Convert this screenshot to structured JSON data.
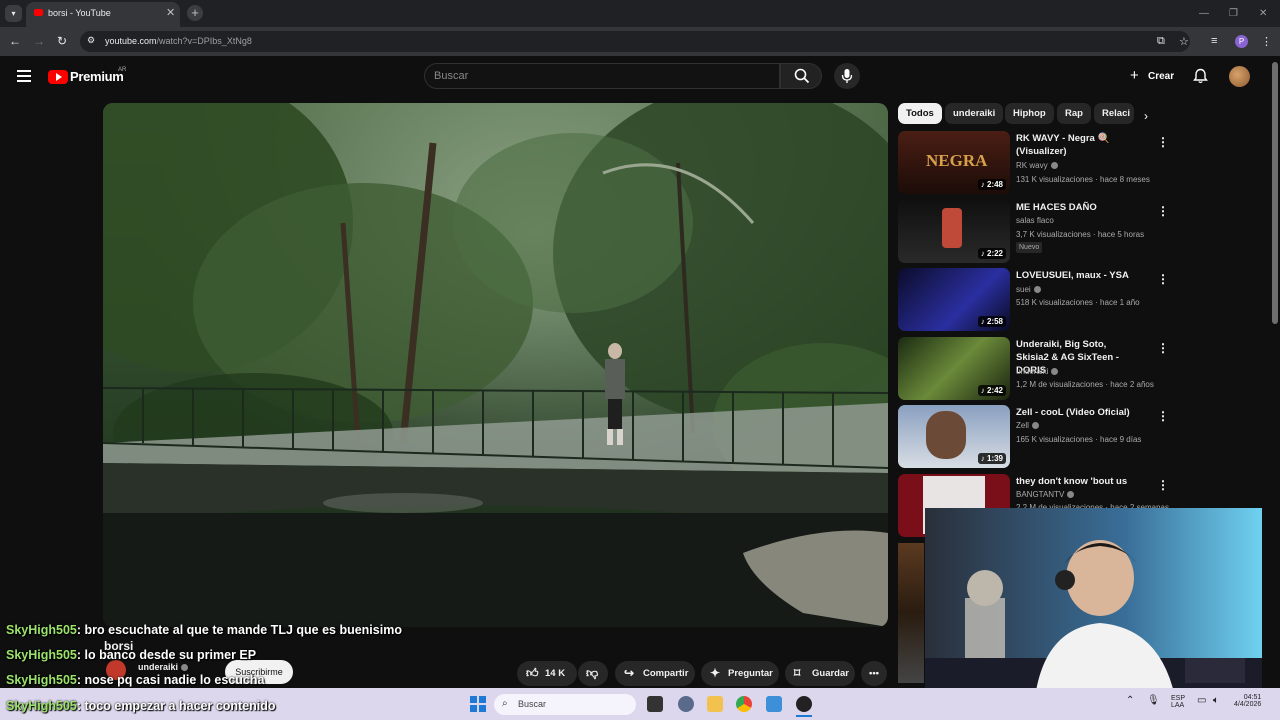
{
  "browser": {
    "tab_title": "borsi - YouTube",
    "url_host": "youtube.com",
    "url_path": "/watch?v=DPIbs_XtNg8",
    "profile_initial": "P"
  },
  "header": {
    "brand": "Premium",
    "country": "AR",
    "search_placeholder": "Buscar",
    "create_label": "Crear"
  },
  "chips": [
    "Todos",
    "underaiki",
    "Hiphop",
    "Rap",
    "Relaci"
  ],
  "recommendations": [
    {
      "title": "RK WAVY - Negra 🍭 (Visualizer)",
      "channel": "RK wavy",
      "meta": "131 K visualizaciones · hace 8 meses",
      "duration": "♪ 2:48"
    },
    {
      "title": "ME HACES DAÑO",
      "channel": "salas flaco",
      "meta": "3,7 K visualizaciones · hace 5 horas",
      "duration": "♪ 2:22",
      "badge": "Nuevo"
    },
    {
      "title": "LOVEUSUEI, maux - YSA",
      "channel": "suei",
      "meta": "518 K visualizaciones · hace 1 año",
      "duration": "♪ 2:58"
    },
    {
      "title": "Underaiki, Big Soto, Skisia2 & AG SixTeen - DORIS",
      "channel": "underaiki",
      "meta": "1,2 M de visualizaciones · hace 2 años",
      "duration": "♪ 2:42"
    },
    {
      "title": "Zell - cooL (Video Oficial)",
      "channel": "Zell",
      "meta": "165 K visualizaciones · hace 9 días",
      "duration": "♪ 1:39"
    },
    {
      "title": "they don't know 'bout us",
      "channel": "BANGTANTV",
      "meta": "2,2 M de visualizaciones · hace 2 semanas",
      "duration": ""
    }
  ],
  "video": {
    "title": "borsi",
    "channel": "underaiki",
    "subscribe": "Suscribirme",
    "likes": "14 K",
    "share": "Compartir",
    "ask": "Preguntar",
    "save": "Guardar"
  },
  "chat": [
    {
      "user": "SkyHigh505",
      "msg": ": bro escuchate al que te mande TLJ que es buenisimo"
    },
    {
      "user": "SkyHigh505",
      "msg": ": lo banco desde su primer EP"
    },
    {
      "user": "SkyHigh505",
      "msg": ": nose pq casi nadie lo escucha"
    },
    {
      "user": "SkyHigh505",
      "msg": ": toco empezar a hacer contenido"
    }
  ],
  "taskbar": {
    "search": "Buscar",
    "lang1": "ESP",
    "lang2": "LAA",
    "time": "04:51",
    "date": "4/4/2026"
  },
  "colors": {
    "accent_red": "#ff0000",
    "chat_user": "#9be36a",
    "taskbar": "#ddd7ee"
  }
}
